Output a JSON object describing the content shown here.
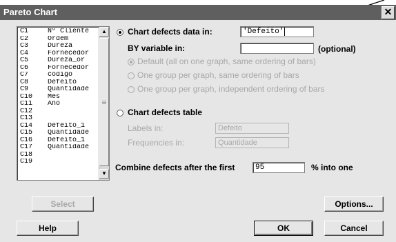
{
  "window": {
    "title": "Pareto Chart"
  },
  "variables": [
    {
      "col": "C1",
      "name": "Nº Cliente"
    },
    {
      "col": "C2",
      "name": "Ordem"
    },
    {
      "col": "C3",
      "name": "Dureza"
    },
    {
      "col": "C4",
      "name": "Fornecedor"
    },
    {
      "col": "C5",
      "name": "Dureza_or"
    },
    {
      "col": "C6",
      "name": "Fornecedor"
    },
    {
      "col": "C7",
      "name": "codigo"
    },
    {
      "col": "C8",
      "name": "Defeito"
    },
    {
      "col": "C9",
      "name": "Quantidade"
    },
    {
      "col": "C10",
      "name": "Mês"
    },
    {
      "col": "C11",
      "name": "Ano"
    },
    {
      "col": "C12",
      "name": ""
    },
    {
      "col": "C13",
      "name": ""
    },
    {
      "col": "C14",
      "name": "Defeito_1"
    },
    {
      "col": "C15",
      "name": "Quantidade"
    },
    {
      "col": "C16",
      "name": "Defeito_1"
    },
    {
      "col": "C17",
      "name": "Quantidade"
    },
    {
      "col": "C18",
      "name": ""
    },
    {
      "col": "C19",
      "name": ""
    }
  ],
  "chart_defects_data": {
    "label": "Chart defects data in:",
    "value": "'Defeito'",
    "selected": true
  },
  "by_variable": {
    "label": "BY variable in:",
    "value": "",
    "optional_label": "(optional)"
  },
  "by_options": [
    "Default (all on one graph, same ordering of bars)",
    "One group per graph, same ordering of bars",
    "One group per graph, independent ordering of bars"
  ],
  "chart_defects_table": {
    "label": "Chart defects table",
    "selected": false,
    "labels_label": "Labels in:",
    "labels_value": "Defeito",
    "frequencies_label": "Frequencies in:",
    "frequencies_value": "Quantidade"
  },
  "combine": {
    "label": "Combine defects after the first",
    "value": "95",
    "suffix": "% into one"
  },
  "buttons": {
    "select": "Select",
    "options": "Options...",
    "help": "Help",
    "ok": "OK",
    "cancel": "Cancel"
  },
  "icons": {
    "close": "close-icon",
    "scroll_up": "up-arrow-icon",
    "scroll_down": "down-arrow-icon",
    "annotation_arrow": "arrow-icon"
  }
}
